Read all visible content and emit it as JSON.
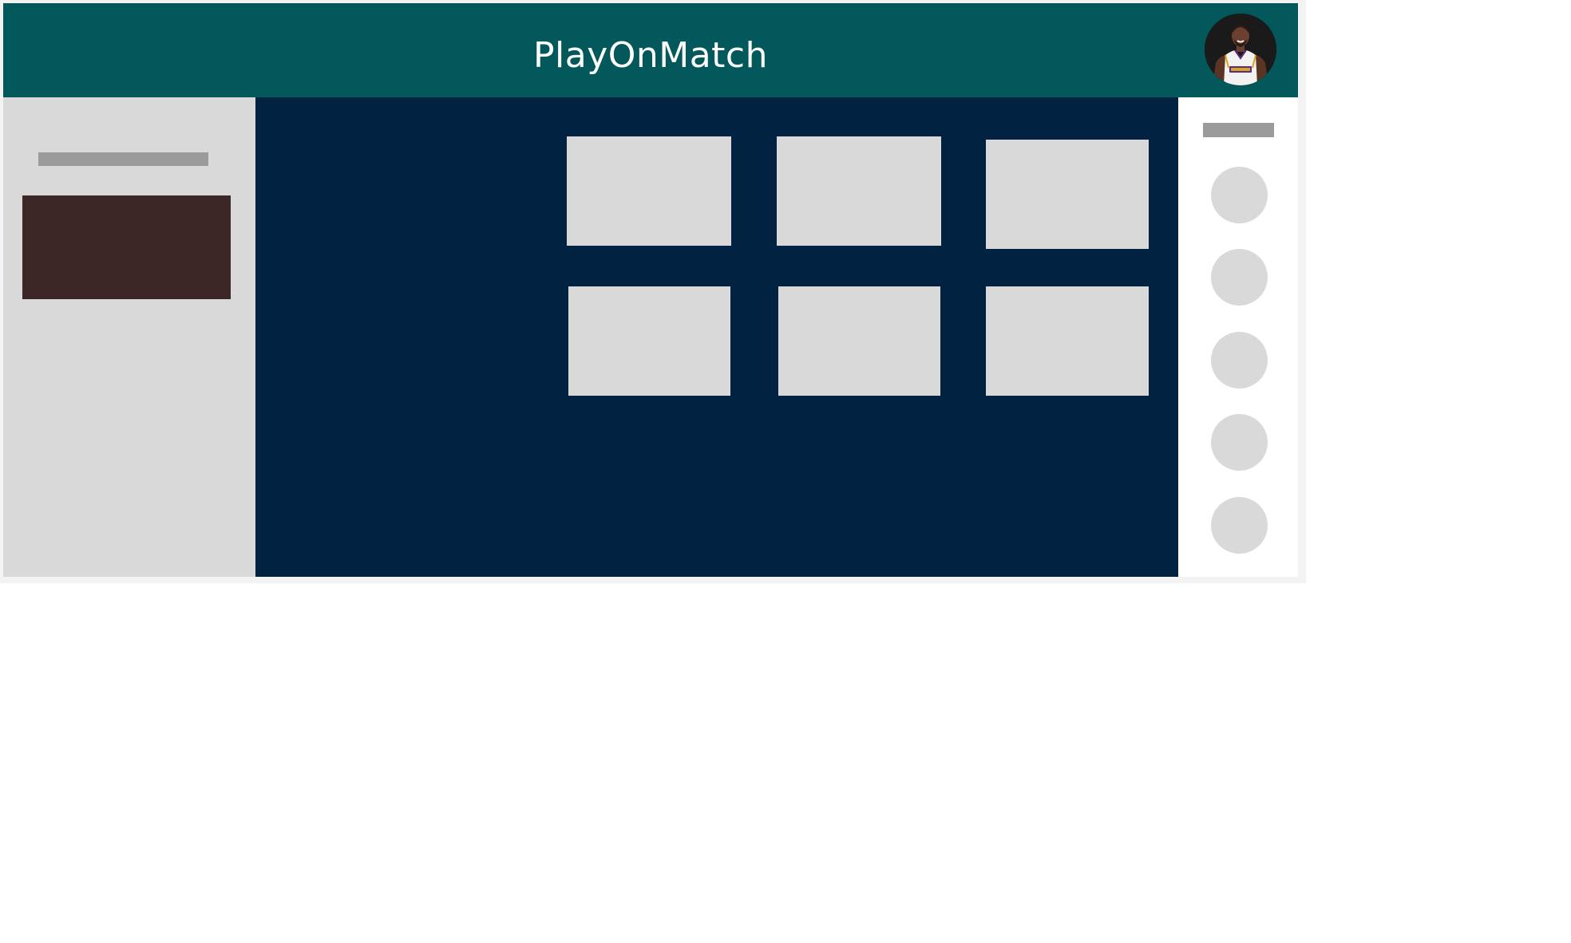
{
  "header": {
    "title": "PlayOnMatch",
    "background_color": "#03585b",
    "avatar_icon": "user-avatar-basketball-player"
  },
  "left_sidebar": {
    "background_color": "#d9d9d9",
    "title_placeholder_color": "#9b9b9b",
    "card_color": "#3c2726"
  },
  "main": {
    "background_color": "#012240",
    "tile_color": "#d9d9d9",
    "tiles": [
      {
        "row": 1,
        "col": 1
      },
      {
        "row": 1,
        "col": 2
      },
      {
        "row": 1,
        "col": 3
      },
      {
        "row": 2,
        "col": 1
      },
      {
        "row": 2,
        "col": 2
      },
      {
        "row": 2,
        "col": 3
      }
    ]
  },
  "right_sidebar": {
    "background_color": "#ffffff",
    "title_placeholder_color": "#9b9b9b",
    "circle_count": 5
  }
}
